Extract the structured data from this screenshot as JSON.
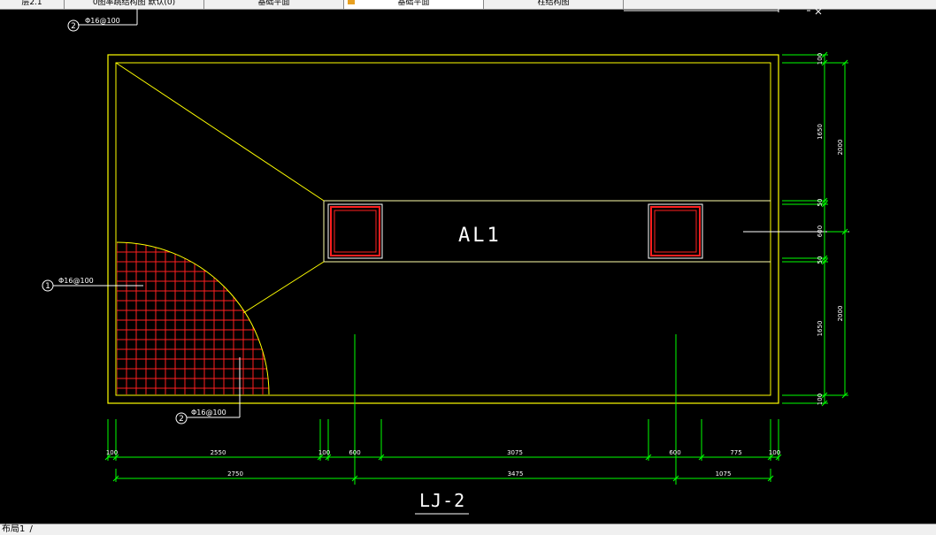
{
  "tabs": [
    {
      "label": "层2.1"
    },
    {
      "label": "0图率跳结构图 默认(0)"
    },
    {
      "label": "基础平面"
    },
    {
      "label": "基础平面"
    },
    {
      "label": "柱结构图"
    }
  ],
  "drawing": {
    "beam_label": "AL1",
    "title": "LJ-2",
    "callout_top": {
      "number": "2",
      "text": "Φ16@100"
    },
    "callout_left": {
      "number": "1",
      "text": "Φ16@100"
    },
    "callout_bottom": {
      "number": "2",
      "text": "Φ16@100"
    }
  },
  "dims_bottom_row1": [
    "100",
    "2550",
    "100",
    "600",
    "3075",
    "600",
    "775",
    "100"
  ],
  "dims_bottom_row2": [
    "2750",
    "3475",
    "1075"
  ],
  "dims_right_col1": [
    "100",
    "1650",
    "50",
    "600",
    "50",
    "1650",
    "100"
  ],
  "dims_right_col2": [
    "2000",
    "2000"
  ],
  "statusbar": {
    "layout_label": "布局1"
  },
  "colors": {
    "outline": "#ffff00",
    "rebar": "#ff2020",
    "dimension": "#00ff00",
    "text": "#ffffff",
    "background": "#000000"
  }
}
